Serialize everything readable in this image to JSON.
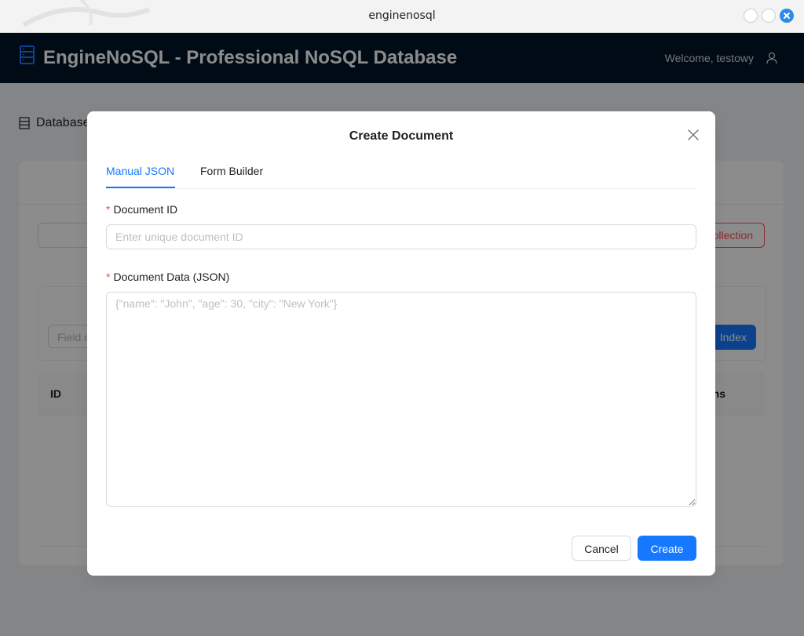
{
  "window": {
    "title": "enginenosql"
  },
  "header": {
    "app_title": "EngineNoSQL - Professional NoSQL Database",
    "welcome": "Welcome, testowy"
  },
  "background": {
    "breadcrumb": "Database",
    "delete_button": "ollection",
    "field_placeholder": "Field n",
    "index_button": "Index",
    "table_headers": [
      "ID",
      "ns"
    ]
  },
  "modal": {
    "title": "Create Document",
    "tabs": [
      {
        "label": "Manual JSON",
        "active": true
      },
      {
        "label": "Form Builder",
        "active": false
      }
    ],
    "document_id": {
      "required_mark": "*",
      "label": "Document ID",
      "value": "",
      "placeholder": "Enter unique document ID"
    },
    "document_data": {
      "required_mark": "*",
      "label": "Document Data (JSON)",
      "value": "",
      "placeholder": "{\"name\": \"John\", \"age\": 30, \"city\": \"New York\"}"
    },
    "cancel_label": "Cancel",
    "create_label": "Create"
  },
  "colors": {
    "primary": "#1677ff",
    "header_bg": "#001529",
    "danger": "#ff4d4f"
  }
}
